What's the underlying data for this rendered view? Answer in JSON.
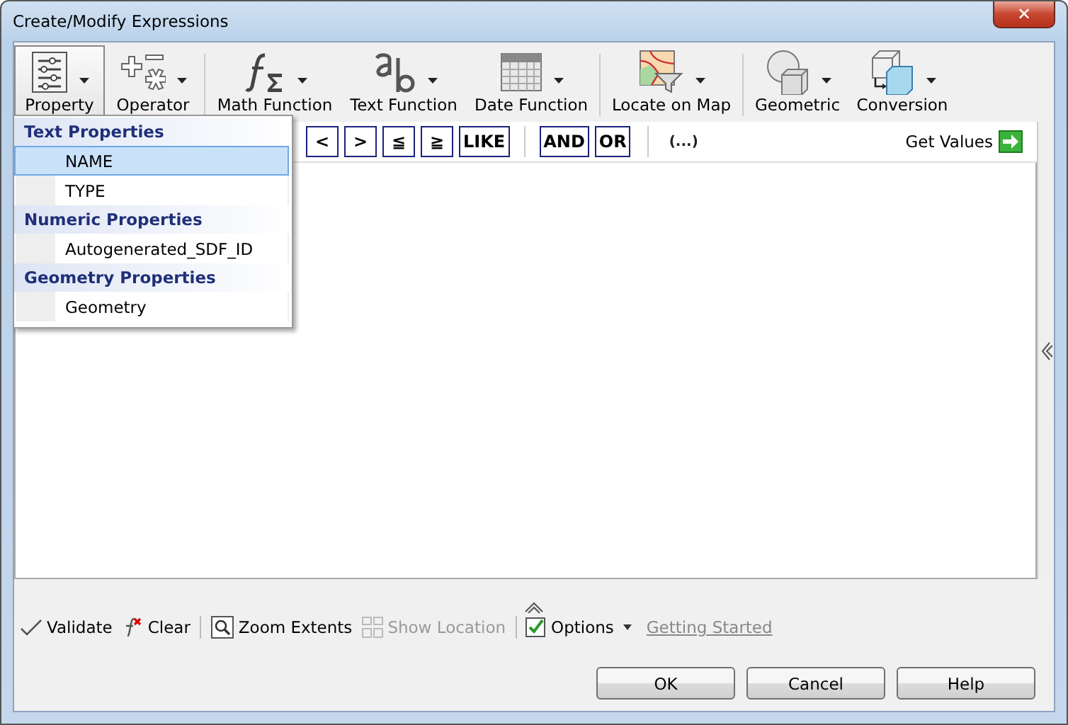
{
  "window": {
    "title": "Create/Modify Expressions",
    "close": "✕"
  },
  "toolbar": [
    {
      "label": "Property",
      "selected": true
    },
    {
      "label": "Operator",
      "selected": false
    },
    {
      "label": "Math Function",
      "selected": false
    },
    {
      "label": "Text Function",
      "selected": false
    },
    {
      "label": "Date Function",
      "selected": false
    },
    {
      "label": "Locate on Map",
      "selected": false
    },
    {
      "label": "Geometric",
      "selected": false
    },
    {
      "label": "Conversion",
      "selected": false
    }
  ],
  "operators": [
    {
      "kind": "op",
      "label": "<"
    },
    {
      "kind": "op",
      "label": ">"
    },
    {
      "kind": "op",
      "label": "≦"
    },
    {
      "kind": "op",
      "label": "≧"
    },
    {
      "kind": "op",
      "label": "LIKE"
    },
    {
      "kind": "sep"
    },
    {
      "kind": "op",
      "label": "AND"
    },
    {
      "kind": "op",
      "label": "OR"
    },
    {
      "kind": "sep"
    },
    {
      "kind": "text",
      "label": "(...)"
    }
  ],
  "get_values": "Get Values",
  "property_menu": [
    {
      "header": "Text Properties",
      "items": [
        {
          "label": "NAME",
          "selected": true
        },
        {
          "label": "TYPE",
          "selected": false
        }
      ]
    },
    {
      "header": "Numeric Properties",
      "items": [
        {
          "label": "Autogenerated_SDF_ID",
          "selected": false
        }
      ]
    },
    {
      "header": "Geometry Properties",
      "items": [
        {
          "label": "Geometry",
          "selected": false
        }
      ]
    }
  ],
  "bottom_tools": [
    {
      "kind": "tool",
      "label": "Validate",
      "disabled": false
    },
    {
      "kind": "tool",
      "label": "Clear",
      "disabled": false
    },
    {
      "kind": "sep"
    },
    {
      "kind": "tool",
      "label": "Zoom Extents",
      "disabled": false
    },
    {
      "kind": "tool",
      "label": "Show Location",
      "disabled": true
    },
    {
      "kind": "sep"
    },
    {
      "kind": "check",
      "label": "Options",
      "checked": true
    },
    {
      "kind": "link",
      "label": "Getting Started"
    }
  ],
  "dialog_buttons": [
    "OK",
    "Cancel",
    "Help"
  ]
}
